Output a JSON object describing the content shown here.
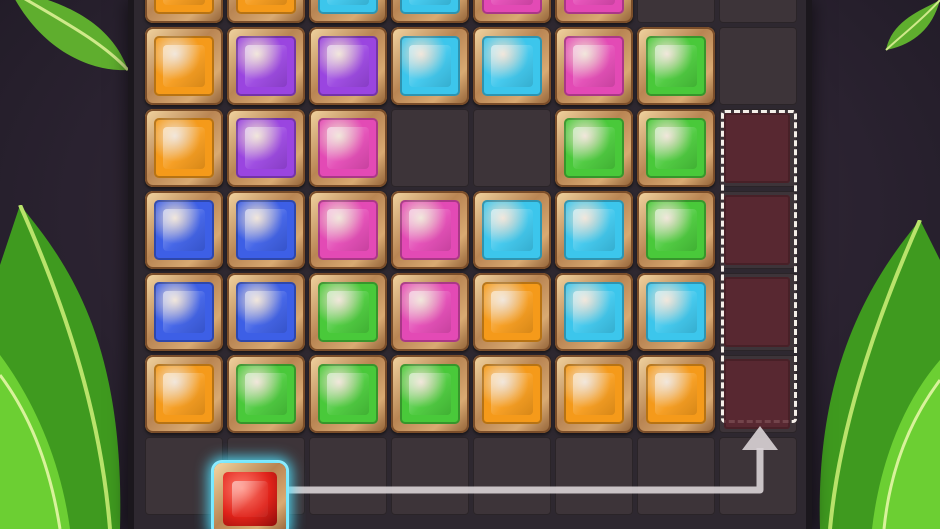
{
  "colors": {
    "orange": "#f59a1a",
    "purple": "#9a45e0",
    "cyan": "#3cc6ec",
    "pink": "#e34ab5",
    "green": "#49c93a",
    "blue": "#3d5fe6",
    "red": "#e0231a",
    "frame": "#c8945e",
    "highlight": "#4fe3ff"
  },
  "board": {
    "rows": [
      [
        "orange",
        "orange",
        "cyan",
        "cyan",
        "pink",
        "pink",
        "empty",
        "empty"
      ],
      [
        "orange",
        "purple",
        "purple",
        "cyan",
        "cyan",
        "pink",
        "green",
        "empty"
      ],
      [
        "orange",
        "purple",
        "pink",
        "empty",
        "empty",
        "green",
        "green",
        "target"
      ],
      [
        "blue",
        "blue",
        "pink",
        "pink",
        "cyan",
        "cyan",
        "green",
        "target"
      ],
      [
        "blue",
        "blue",
        "green",
        "pink",
        "orange",
        "cyan",
        "cyan",
        "target"
      ],
      [
        "orange",
        "green",
        "green",
        "green",
        "orange",
        "orange",
        "orange",
        "target"
      ],
      [
        "empty",
        "empty",
        "empty",
        "empty",
        "empty",
        "empty",
        "empty",
        "empty"
      ]
    ]
  },
  "active_piece": {
    "color": "red",
    "icon": "red-gem-block-icon"
  },
  "hint": {
    "icon": "drag-path-arrow-icon"
  }
}
